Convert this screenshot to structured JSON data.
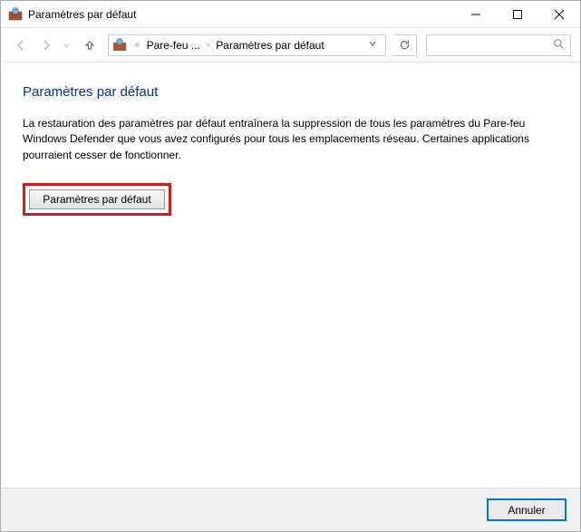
{
  "window": {
    "title": "Paramètres par défaut"
  },
  "breadcrumb": {
    "prefix": "«",
    "item1": "Pare-feu ...",
    "item2": "Paramètres par défaut"
  },
  "search": {
    "placeholder": ""
  },
  "page": {
    "heading": "Paramètres par défaut",
    "body": "La restauration des paramètres par défaut entraînera la suppression de tous les paramètres du Pare-feu Windows Defender que vous avez configurés pour tous les emplacements réseau. Certaines applications pourraient cesser de fonctionner.",
    "defaults_button": "Paramètres par défaut"
  },
  "footer": {
    "cancel": "Annuler"
  }
}
